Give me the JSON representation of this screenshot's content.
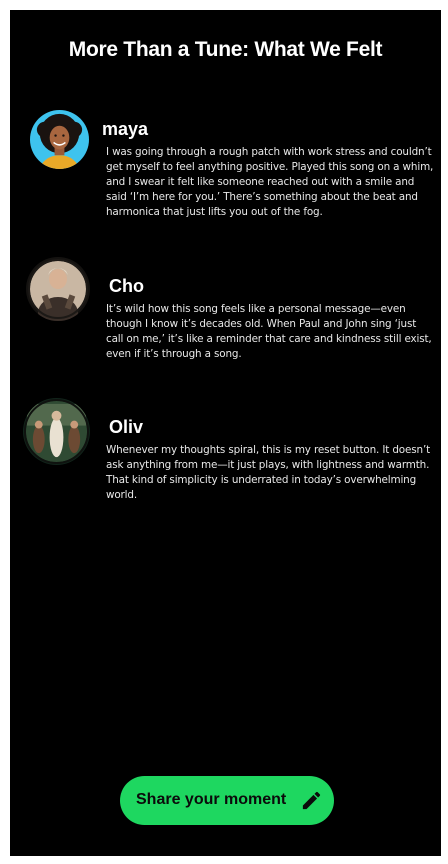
{
  "page": {
    "title": "More Than a Tune: What We Felt"
  },
  "posts": [
    {
      "author": "maya",
      "avatar_icon": "woman-portrait-avatar",
      "text": "I was going through a rough patch with work stress and couldn’t get myself to feel anything positive. Played this song on a whim, and I swear it felt like someone reached out with a smile and said ‘I’m here for you.’ There’s something about the beat and harmonica that just lifts you out of the fog."
    },
    {
      "author": "Cho",
      "avatar_icon": "person-photo-avatar",
      "text": "It’s wild how this song feels like a personal message—even though I know it’s decades old. When Paul and John sing ‘just call on me,’ it’s like a reminder that care and kindness still exist, even if it’s through a song."
    },
    {
      "author": "Oliv",
      "avatar_icon": "group-photo-avatar",
      "text": "Whenever my thoughts spiral, this is my reset button. It doesn’t ask anything from me—it just plays, with lightness and warmth. That kind of simplicity is underrated in today’s overwhelming world."
    }
  ],
  "share_button": {
    "label": "Share your moment",
    "icon": "pencil-icon"
  },
  "colors": {
    "background": "#000000",
    "accent": "#1ed760",
    "text": "#ffffff"
  }
}
